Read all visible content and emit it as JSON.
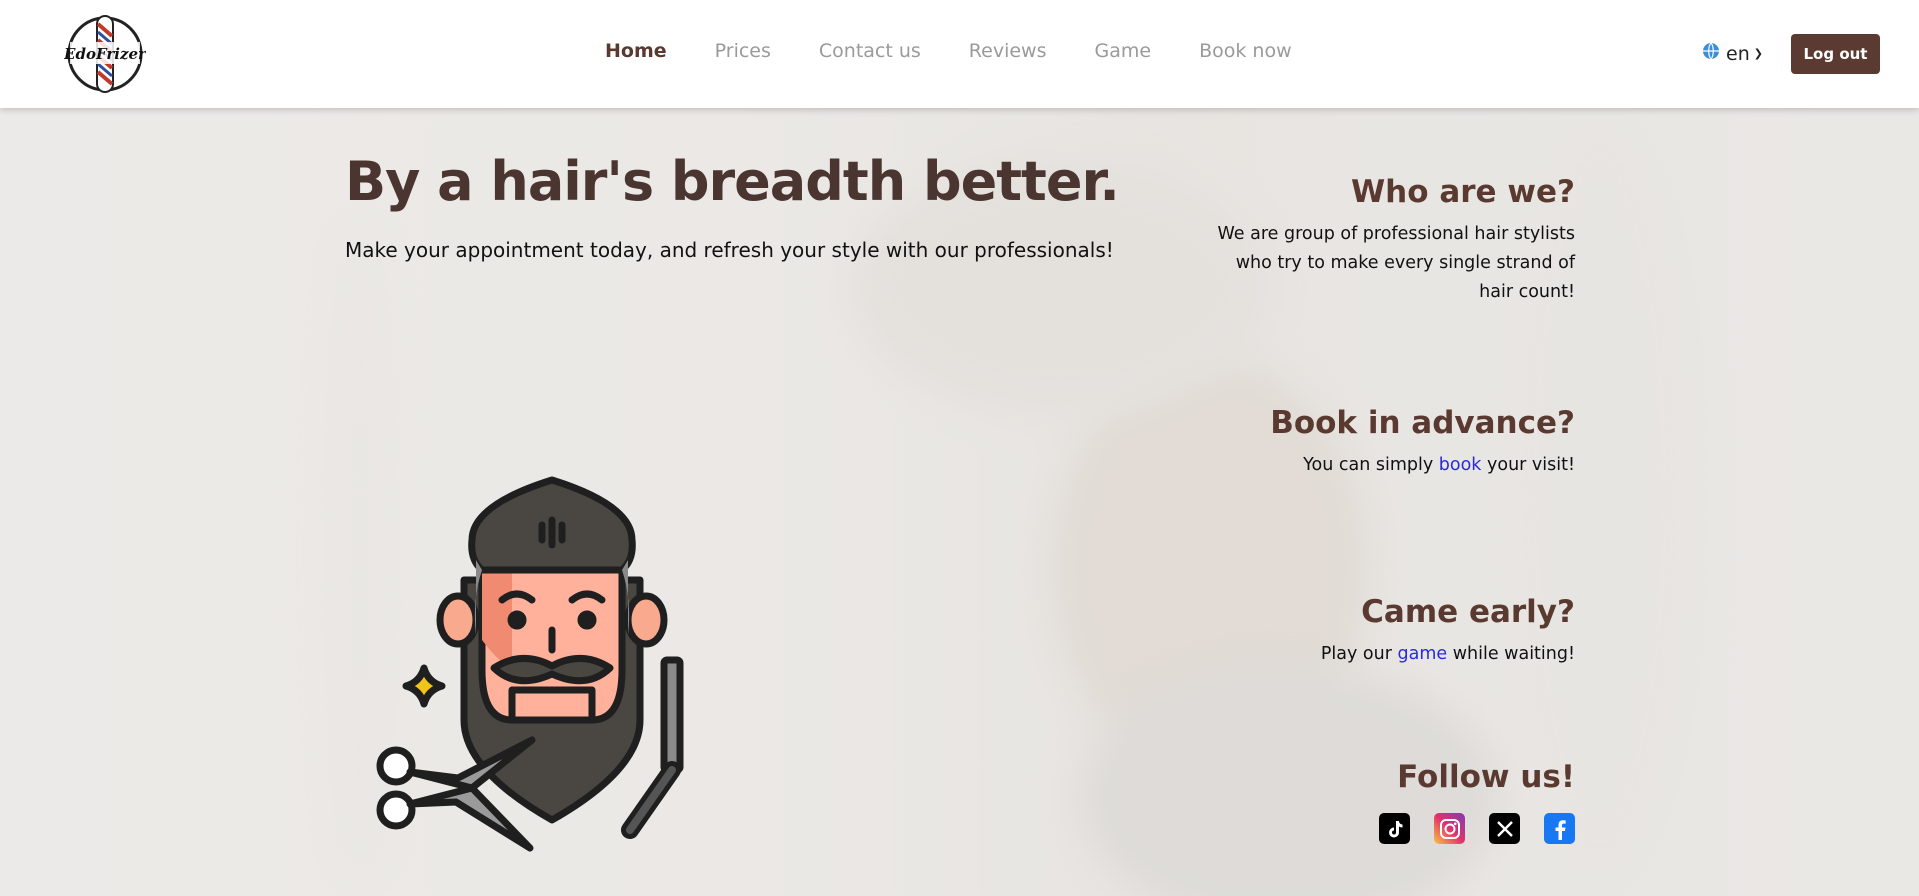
{
  "nav": {
    "logo_text": "EdoFrizer",
    "links": [
      {
        "label": "Home",
        "active": true
      },
      {
        "label": "Prices",
        "active": false
      },
      {
        "label": "Contact us",
        "active": false
      },
      {
        "label": "Reviews",
        "active": false
      },
      {
        "label": "Game",
        "active": false
      },
      {
        "label": "Book now",
        "active": false
      }
    ],
    "language": "en",
    "logout_label": "Log out"
  },
  "hero": {
    "title": "By a hair's breadth better.",
    "subtitle": "Make your appointment today, and refresh your style with our professionals!"
  },
  "about": {
    "heading": "Who are we?",
    "text": "We are group of professional hair stylists who try to make every single strand of hair count!"
  },
  "book": {
    "heading": "Book in advance?",
    "text_before": "You can simply ",
    "link": "book",
    "text_after": " your visit!"
  },
  "early": {
    "heading": "Came early?",
    "text_before": "Play our ",
    "link": "game",
    "text_after": " while waiting!"
  },
  "follow": {
    "heading": "Follow us!",
    "icons": [
      "tiktok-icon",
      "instagram-icon",
      "x-icon",
      "facebook-icon"
    ]
  },
  "colors": {
    "brand": "#5b3a31",
    "heading": "#4b3530",
    "link": "#2a2ad9",
    "nav_inactive": "#9a9a9a"
  }
}
